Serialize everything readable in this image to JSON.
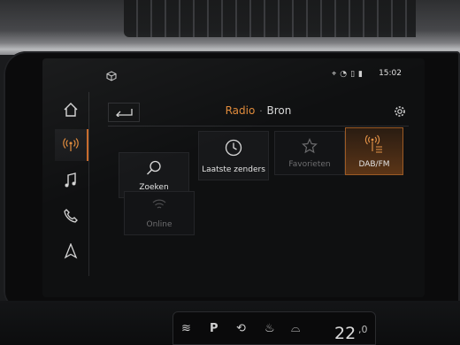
{
  "header": {
    "title_primary": "Radio",
    "separator": "·",
    "title_secondary": "Bron"
  },
  "status": {
    "time": "15:02"
  },
  "sidebar": {
    "items": [
      {
        "name": "home",
        "icon": "home-icon"
      },
      {
        "name": "radio",
        "icon": "radio-icon",
        "active": true
      },
      {
        "name": "media",
        "icon": "music-note-icon"
      },
      {
        "name": "phone",
        "icon": "phone-icon"
      },
      {
        "name": "navigation",
        "icon": "navigation-arrow-icon"
      }
    ]
  },
  "tiles": [
    {
      "label": "Zoeken",
      "icon": "search-icon",
      "state": "normal"
    },
    {
      "label": "Laatste zenders",
      "icon": "recent-clock-icon",
      "state": "normal"
    },
    {
      "label": "Favorieten",
      "icon": "star-icon",
      "state": "disabled"
    },
    {
      "label": "DAB/FM",
      "icon": "dab-fm-antenna-icon",
      "state": "selected"
    },
    {
      "label": "Online",
      "icon": "wifi-icon",
      "state": "disabled"
    }
  ],
  "climate": {
    "temperature": "22",
    "unit": ",0"
  },
  "colors": {
    "accent": "#e08a3a",
    "screen_bg": "#0f1011",
    "tile_bg": "#17181a"
  }
}
